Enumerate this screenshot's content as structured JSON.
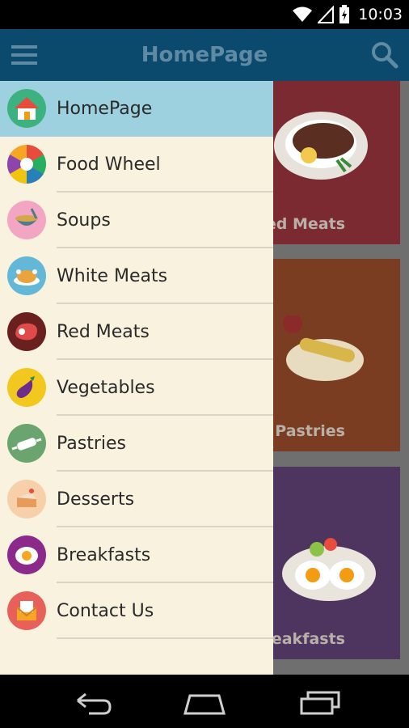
{
  "status_bar": {
    "time": "10:03"
  },
  "app_bar": {
    "title": "HomePage",
    "menu_icon": "hamburger-icon",
    "search_icon": "search-icon"
  },
  "colors": {
    "app_bar": "#0b4a6d",
    "drawer_bg": "#f8f2de",
    "drawer_active": "#9ed1df"
  },
  "drawer": {
    "items": [
      {
        "label": "HomePage",
        "icon": "home-icon",
        "active": true
      },
      {
        "label": "Food Wheel",
        "icon": "food-wheel-icon"
      },
      {
        "label": "Soups",
        "icon": "soup-icon"
      },
      {
        "label": "White Meats",
        "icon": "chicken-icon"
      },
      {
        "label": "Red Meats",
        "icon": "steak-icon"
      },
      {
        "label": "Vegetables",
        "icon": "eggplant-icon"
      },
      {
        "label": "Pastries",
        "icon": "rolling-pin-icon"
      },
      {
        "label": "Desserts",
        "icon": "cake-icon"
      },
      {
        "label": "Breakfasts",
        "icon": "egg-icon"
      },
      {
        "label": "Contact Us",
        "icon": "mail-icon"
      }
    ]
  },
  "cards": [
    {
      "label": "ed Meats",
      "image": "steak-plate-image"
    },
    {
      "label": "Pastries",
      "image": "pastry-image"
    },
    {
      "label": "reakfasts",
      "image": "breakfast-plate-image"
    }
  ],
  "nav_bar": {
    "back": "back-icon",
    "home": "home-nav-icon",
    "recents": "recents-icon"
  }
}
